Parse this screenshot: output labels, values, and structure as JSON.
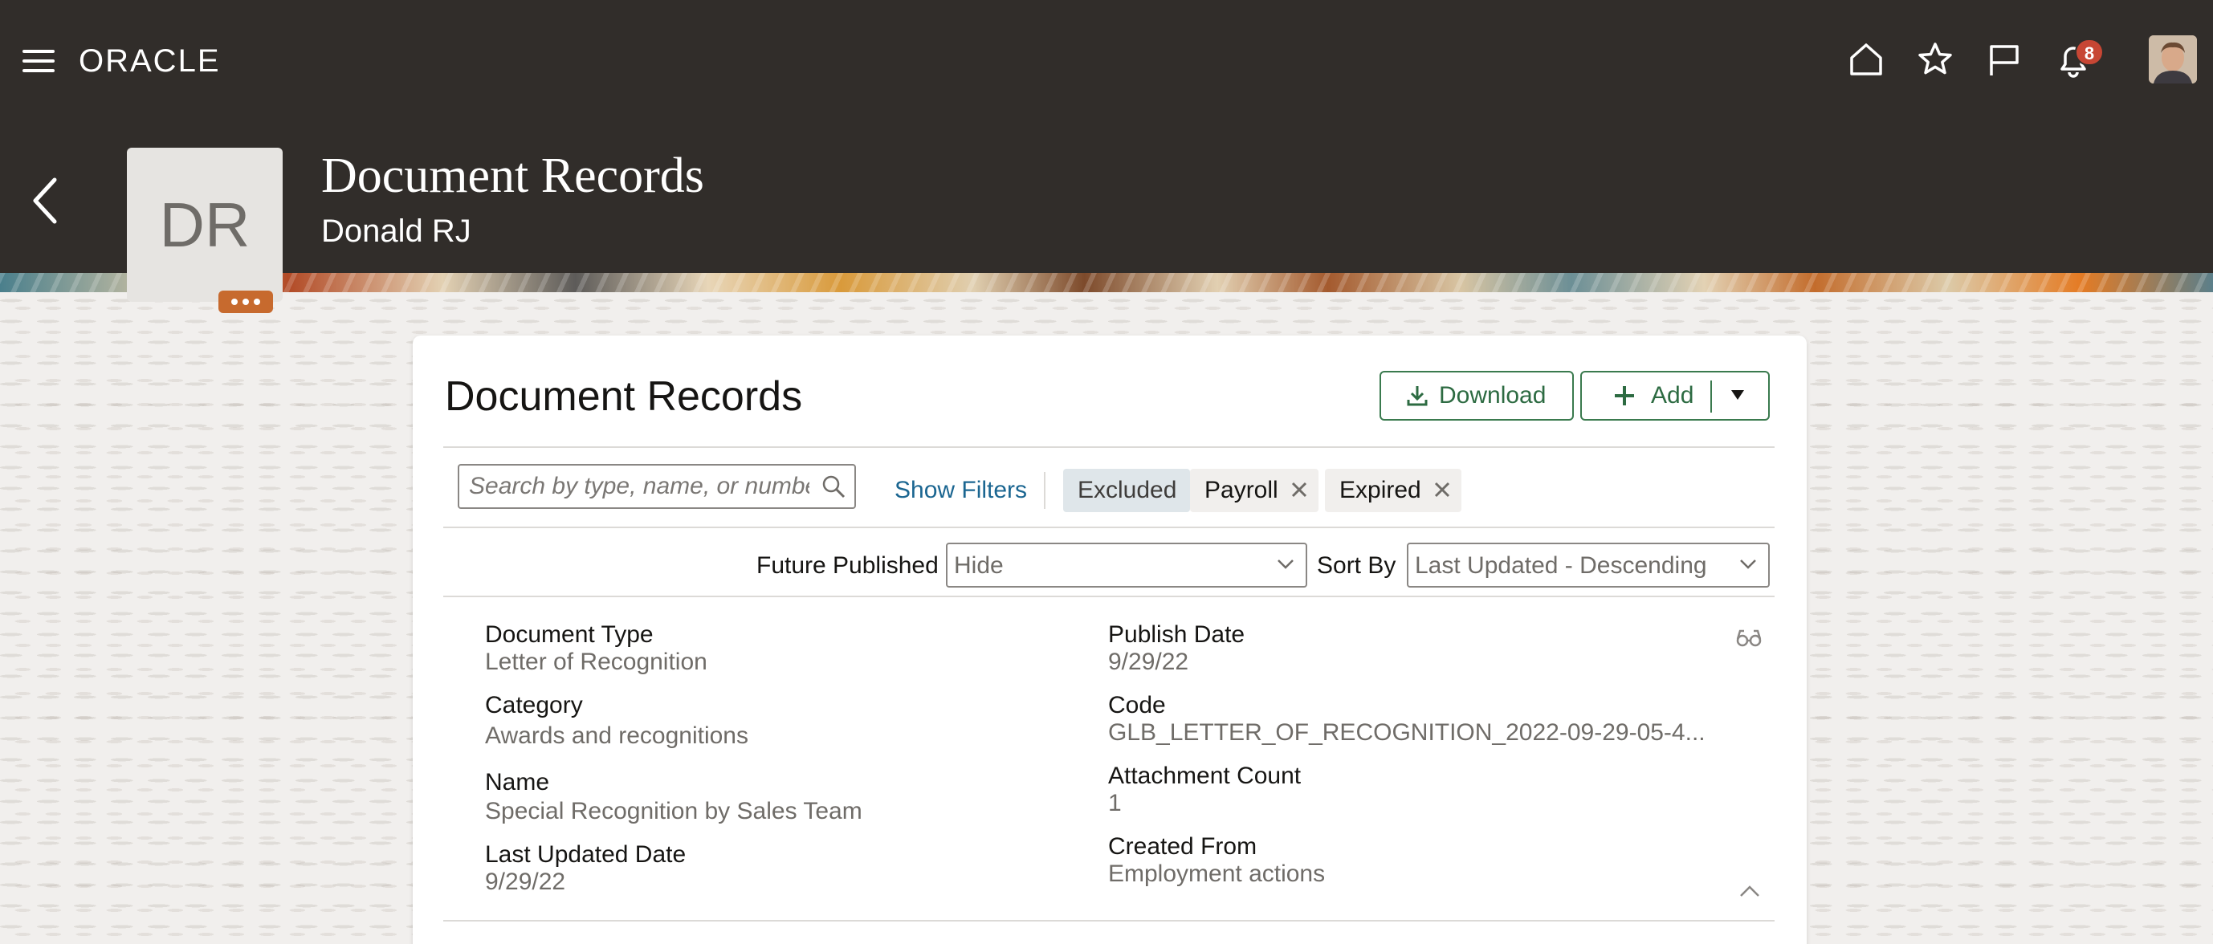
{
  "header": {
    "logo": "ORACLE",
    "notification_count": "8",
    "avatar_initials": "DR",
    "title": "Document Records",
    "subtitle": "Donald RJ"
  },
  "card": {
    "title": "Document Records",
    "download_label": "Download",
    "add_label": "Add",
    "search_placeholder": "Search by type, name, or number",
    "show_filters_label": "Show Filters",
    "filter_chips": [
      {
        "label": "Excluded",
        "removable": false
      },
      {
        "label": "Payroll",
        "removable": true
      },
      {
        "label": "Expired",
        "removable": true
      }
    ],
    "future_published_label": "Future Published",
    "future_published_value": "Hide",
    "sort_by_label": "Sort By",
    "sort_by_value": "Last Updated - Descending"
  },
  "record": {
    "document_type_label": "Document Type",
    "document_type": "Letter of Recognition",
    "category_label": "Category",
    "category": "Awards and recognitions",
    "name_label": "Name",
    "name": "Special Recognition by Sales Team",
    "last_updated_label": "Last Updated Date",
    "last_updated": "9/29/22",
    "publish_date_label": "Publish Date",
    "publish_date": "9/29/22",
    "code_label": "Code",
    "code": "GLB_LETTER_OF_RECOGNITION_2022-09-29-05-4...",
    "attachment_count_label": "Attachment Count",
    "attachment_count": "1",
    "created_from_label": "Created From",
    "created_from": "Employment actions"
  },
  "colors": {
    "header_bg": "#312d2a",
    "accent_green": "#2d6b42",
    "link_blue": "#1b6691",
    "badge_red": "#c74634",
    "more_orange": "#c76a2e"
  }
}
